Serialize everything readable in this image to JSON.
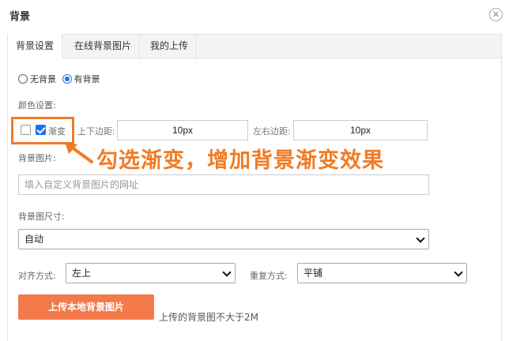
{
  "dialog": {
    "title": "背景",
    "close_icon": "close-icon"
  },
  "tabs": [
    {
      "label": "背景设置",
      "active": true
    },
    {
      "label": "在线背景图片",
      "active": false
    },
    {
      "label": "我的上传",
      "active": false
    }
  ],
  "background_mode": {
    "options": [
      "无背景",
      "有背景"
    ],
    "selected": "有背景"
  },
  "color_settings": {
    "label": "颜色设置:",
    "color_checkbox_checked": false,
    "gradient_checkbox_checked": true,
    "gradient_label": "渐变",
    "vertical_margin_label": "上下边距:",
    "vertical_margin_value": "10px",
    "horizontal_margin_label": "左右边距:",
    "horizontal_margin_value": "10px"
  },
  "annotation": {
    "text": "勾选渐变，增加背景渐变效果",
    "color": "#f27b25"
  },
  "background_image": {
    "label": "背景图片:",
    "placeholder": "填入自定义背景图片的网址"
  },
  "image_size": {
    "label": "背景图尺寸:",
    "selected": "自动"
  },
  "alignment": {
    "label": "对齐方式:",
    "selected": "左上"
  },
  "repeat": {
    "label": "重复方式:",
    "selected": "平铺"
  },
  "upload": {
    "button_label": "上传本地背景图片",
    "hint": "上传的背景图不大于2M",
    "button_color": "#f37b4b"
  },
  "colors": {
    "accent_blue": "#1a73e8",
    "highlight_orange": "#f07c28"
  }
}
